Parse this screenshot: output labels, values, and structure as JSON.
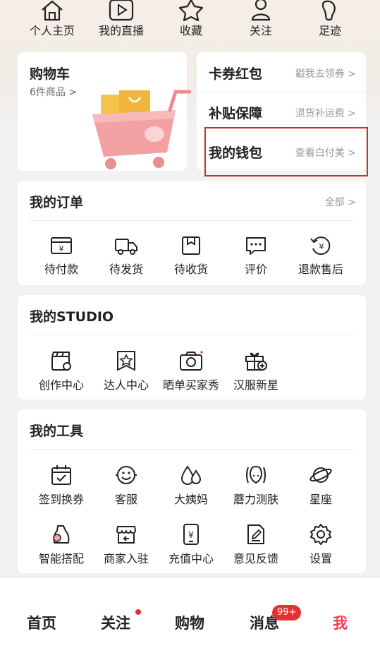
{
  "quick_links": [
    {
      "label": "个人主页",
      "icon": "home-icon"
    },
    {
      "label": "我的直播",
      "icon": "play-icon"
    },
    {
      "label": "收藏",
      "icon": "star-icon"
    },
    {
      "label": "关注",
      "icon": "follow-user-icon"
    },
    {
      "label": "足迹",
      "icon": "footprint-icon"
    }
  ],
  "cart": {
    "title": "购物车",
    "subtitle": "6件商品 >"
  },
  "right_panel": [
    {
      "title": "卡券红包",
      "sub": "戳我去领券 >"
    },
    {
      "title": "补贴保障",
      "sub": "退货补运费 >"
    },
    {
      "title": "我的钱包",
      "sub": "查看白付美 >"
    }
  ],
  "orders": {
    "title": "我的订单",
    "link": "全部 >",
    "items": [
      {
        "label": "待付款",
        "icon": "wallet-icon"
      },
      {
        "label": "待发货",
        "icon": "truck-icon"
      },
      {
        "label": "待收货",
        "icon": "box-icon"
      },
      {
        "label": "评价",
        "icon": "comment-icon"
      },
      {
        "label": "退款售后",
        "icon": "refund-icon"
      }
    ]
  },
  "studio": {
    "title": "我的STUDIO",
    "items": [
      {
        "label": "创作中心",
        "icon": "clapperboard-icon"
      },
      {
        "label": "达人中心",
        "icon": "star-badge-icon"
      },
      {
        "label": "晒单买家秀",
        "icon": "camera-icon"
      },
      {
        "label": "汉服新星",
        "icon": "gift-icon"
      }
    ]
  },
  "tools": {
    "title": "我的工具",
    "items": [
      {
        "label": "签到换券",
        "icon": "calendar-check-icon"
      },
      {
        "label": "客服",
        "icon": "smiley-icon"
      },
      {
        "label": "大姨妈",
        "icon": "drops-icon"
      },
      {
        "label": "蘑力测肤",
        "icon": "face-scan-icon"
      },
      {
        "label": "星座",
        "icon": "planet-icon"
      },
      {
        "label": "智能搭配",
        "icon": "outfit-icon"
      },
      {
        "label": "商家入驻",
        "icon": "shop-icon"
      },
      {
        "label": "充值中心",
        "icon": "phone-yuan-icon"
      },
      {
        "label": "意见反馈",
        "icon": "feedback-icon"
      },
      {
        "label": "设置",
        "icon": "gear-icon"
      }
    ]
  },
  "tabbar": {
    "items": [
      {
        "label": "首页"
      },
      {
        "label": "关注"
      },
      {
        "label": "购物"
      },
      {
        "label": "消息"
      },
      {
        "label": "我"
      }
    ],
    "message_badge": "99+",
    "active_color": "#e64552"
  }
}
